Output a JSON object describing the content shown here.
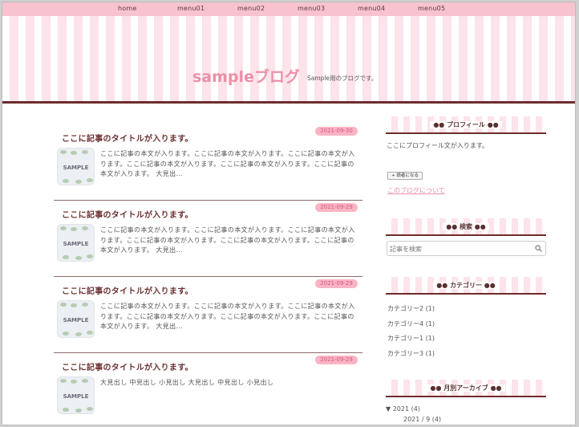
{
  "nav": [
    "home",
    "menu01",
    "menu02",
    "menu03",
    "menu04",
    "menu05"
  ],
  "site": {
    "title": "sampleブログ",
    "description": "Sample用のブログです。"
  },
  "posts": [
    {
      "date": "2021-09-30",
      "title": "ここに記事のタイトルが入ります。",
      "thumb": "SAMPLE",
      "excerpt": "ここに記事の本文が入ります。ここに記事の本文が入ります。ここに記事の本文が入ります。ここに記事の本文が入ります。ここに記事の本文が入ります。ここに記事の本文が入ります。 大見出..."
    },
    {
      "date": "2021-09-29",
      "title": "ここに記事のタイトルが入ります。",
      "thumb": "SAMPLE",
      "excerpt": "ここに記事の本文が入ります。ここに記事の本文が入ります。ここに記事の本文が入ります。ここに記事の本文が入ります。ここに記事の本文が入ります。ここに記事の本文が入ります。 大見出..."
    },
    {
      "date": "2021-09-29",
      "title": "ここに記事のタイトルが入ります。",
      "thumb": "SAMPLE",
      "excerpt": "ここに記事の本文が入ります。ここに記事の本文が入ります。ここに記事の本文が入ります。ここに記事の本文が入ります。ここに記事の本文が入ります。ここに記事の本文が入ります。 大見出..."
    },
    {
      "date": "2021-09-29",
      "title": "ここに記事のタイトルが入ります。",
      "thumb": "SAMPLE",
      "excerpt": "大見出し 中見出し 小見出し 大見出し 中見出し 小見出し"
    }
  ],
  "sidebar": {
    "profile_title": "プロフィール",
    "profile_text": "ここにプロフィール文が入ります。",
    "reader_button": "読者になる",
    "about_link": "このブログについて",
    "search_title": "検索",
    "search_placeholder": "記事を検索",
    "category_title": "カテゴリー",
    "categories": [
      "カテゴリー2 (1)",
      "カテゴリー4 (1)",
      "カテゴリー1 (1)",
      "カテゴリー3 (1)"
    ],
    "archive_title": "月別アーカイブ",
    "archive_year": "▼ 2021 (4)",
    "archive_month": "2021 / 9 (4)"
  },
  "colors": {
    "nav": "#f8c3cf",
    "accent": "#ee8fa8",
    "dark": "#6e2c2c",
    "date_badge": "#f9b4c4"
  }
}
